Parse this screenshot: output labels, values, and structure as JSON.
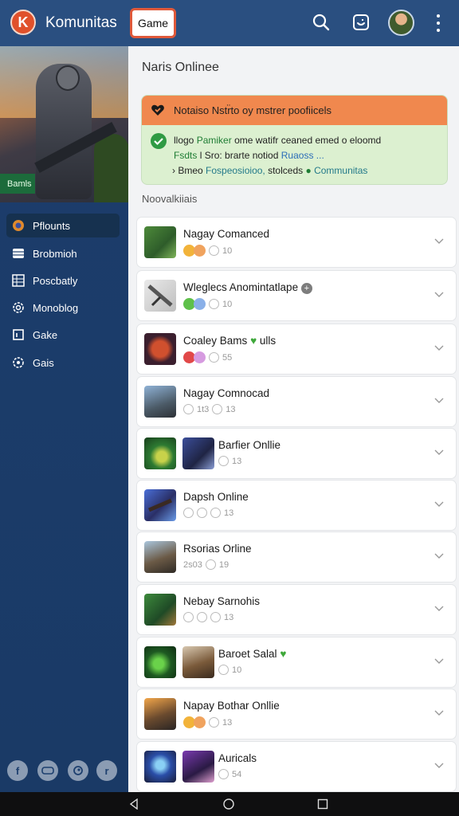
{
  "header": {
    "logo_letter": "K",
    "app_title": "Komunitas",
    "game_button": "Game",
    "icons": [
      "search-icon",
      "chat-icon",
      "avatar",
      "more-icon"
    ]
  },
  "sidebar": {
    "hero_tag": "Bamls",
    "items": [
      {
        "label": "Pflounts",
        "icon": "game-icon",
        "active": true
      },
      {
        "label": "Brobmioh",
        "icon": "list-icon",
        "active": false
      },
      {
        "label": "Poscbatly",
        "icon": "table-icon",
        "active": false
      },
      {
        "label": "Monoblog",
        "icon": "gear-icon",
        "active": false
      },
      {
        "label": "Gake",
        "icon": "square-icon",
        "active": false
      },
      {
        "label": "Gais",
        "icon": "settings-icon",
        "active": false
      }
    ],
    "social": [
      {
        "glyph": "f",
        "icon": "facebook-icon"
      },
      {
        "glyph": "",
        "icon": "controller-icon"
      },
      {
        "glyph": "",
        "icon": "steam-icon"
      },
      {
        "glyph": "r",
        "icon": "reddit-icon"
      }
    ]
  },
  "main": {
    "title": "Naris Onlinee",
    "notice": {
      "head": "Notaiso Nstr̈to oy mstrer poofiicels",
      "line1_a": "llogo",
      "line1_b": "Pamiker",
      "line1_c": "ome watifr ceaned emed o eloomd",
      "line2_a": "Fsdts",
      "line2_b": "l Sro: brarte notiod",
      "line2_c": "Ruaoss ...",
      "line3_a": "› Bmeo",
      "line3_b": "Fospeosioioo,",
      "line3_c": "stolceds",
      "line3_d": "Communitas"
    },
    "section_label": "Noovalkiiais",
    "games": [
      {
        "title": "Nagay Comanced",
        "meta": "10",
        "extra": ""
      },
      {
        "title": "Wleglecs Anomintatlape",
        "meta": "10",
        "extra": ""
      },
      {
        "title": "Coaley Bams",
        "meta": "55",
        "extra": "ulls"
      },
      {
        "title": "Nagay Comnocad",
        "meta": "13",
        "extra": "1t3"
      },
      {
        "title": "Barfier Onllie",
        "meta": "13",
        "extra": ""
      },
      {
        "title": "Dapsh Online",
        "meta": "13",
        "extra": ""
      },
      {
        "title": "Rsorias Orline",
        "meta": "19",
        "extra": "2s03"
      },
      {
        "title": "Nebay Sarnohis",
        "meta": "13",
        "extra": ""
      },
      {
        "title": "Baroet Salal",
        "meta": "10",
        "extra": ""
      },
      {
        "title": "Napay Bothar Onllie",
        "meta": "13",
        "extra": ""
      },
      {
        "title": "Auricals",
        "meta": "54",
        "extra": ""
      }
    ]
  },
  "colors": {
    "topbar": "#2a4f80",
    "sidebar": "#1c3d6c",
    "accent_orange": "#f0884e",
    "notice_green": "#dcf0d0",
    "game_button_border": "#e0593a"
  }
}
